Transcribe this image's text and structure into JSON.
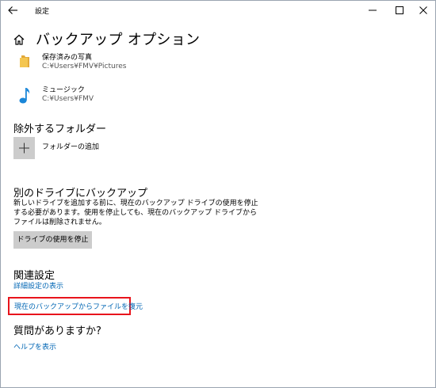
{
  "window": {
    "app_title": "設定",
    "page_title": "バックアップ オプション"
  },
  "folders": [
    {
      "name": "保存済みの写真",
      "path": "C:¥Users¥FMV¥Pictures",
      "icon": "folder-icon",
      "icon_color": "#f4c650"
    },
    {
      "name": "ミュージック",
      "path": "C:¥Users¥FMV",
      "icon": "music-note-icon",
      "icon_color": "#1a86d8"
    }
  ],
  "excluded": {
    "title": "除外するフォルダー",
    "add_label": "フォルダーの追加"
  },
  "other_drive": {
    "title": "別のドライブにバックアップ",
    "description": "新しいドライブを追加する前に、現在のバックアップ ドライブの使用を停止する必要があります。使用を停止しても、現在のバックアップ ドライブからファイルは削除されません。",
    "stop_button": "ドライブの使用を停止"
  },
  "related": {
    "title": "関連設定",
    "advanced_link": "詳細設定の表示",
    "restore_link": "現在のバックアップからファイルを復元"
  },
  "question": {
    "title": "質問がありますか?",
    "help_link": "ヘルプを表示"
  },
  "colors": {
    "link": "#0066b4",
    "highlight": "#e8141c",
    "button_bg": "#cccccc"
  }
}
